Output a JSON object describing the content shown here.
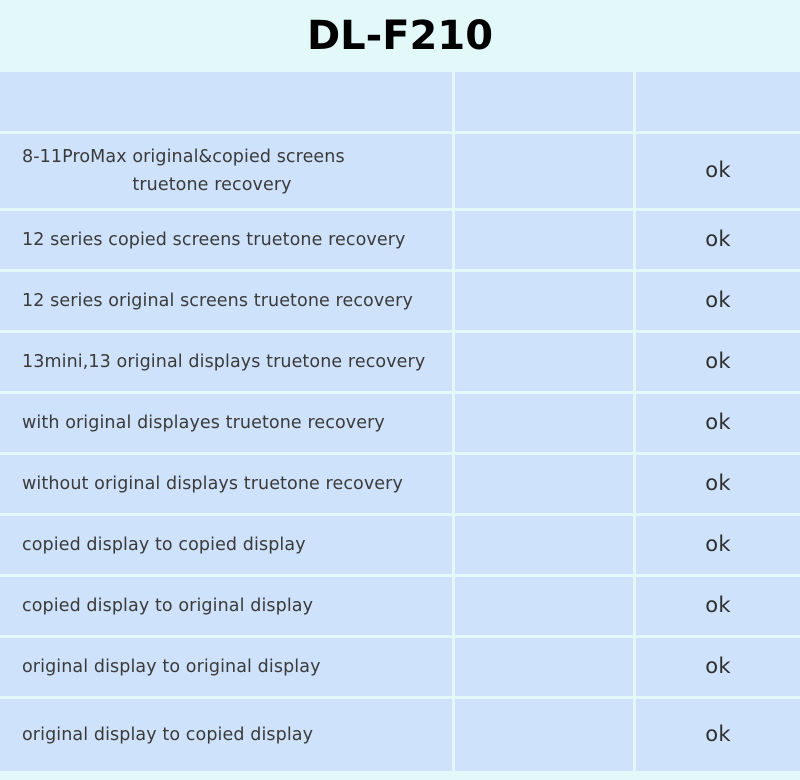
{
  "page": {
    "title": "DL-F210",
    "title_bg": "#e2f8f9",
    "cell_bg": "#cfe2fb",
    "grid_color": "#e2f8f9",
    "text_color": "#3a3a3a"
  },
  "table": {
    "columns": [
      {
        "key": "feature",
        "header": ""
      },
      {
        "key": "middle",
        "header": ""
      },
      {
        "key": "status",
        "header": ""
      }
    ],
    "rows": [
      {
        "feature_line1": "8-11ProMax original&copied screens",
        "feature_line2": "truetone recovery",
        "middle": "",
        "status": "ok"
      },
      {
        "feature_line1": "12 series copied screens truetone recovery",
        "feature_line2": "",
        "middle": "",
        "status": "ok"
      },
      {
        "feature_line1": "12 series original screens truetone recovery",
        "feature_line2": "",
        "middle": "",
        "status": "ok"
      },
      {
        "feature_line1": "13mini,13 original displays truetone recovery",
        "feature_line2": "",
        "middle": "",
        "status": "ok"
      },
      {
        "feature_line1": "with original displayes truetone recovery",
        "feature_line2": "",
        "middle": "",
        "status": "ok"
      },
      {
        "feature_line1": "without original displays truetone recovery",
        "feature_line2": "",
        "middle": "",
        "status": "ok"
      },
      {
        "feature_line1": "copied display to copied display",
        "feature_line2": "",
        "middle": "",
        "status": "ok"
      },
      {
        "feature_line1": "copied display to original display",
        "feature_line2": "",
        "middle": "",
        "status": "ok"
      },
      {
        "feature_line1": "original display to original display",
        "feature_line2": "",
        "middle": "",
        "status": "ok"
      },
      {
        "feature_line1": "original display to copied display",
        "feature_line2": "",
        "middle": "",
        "status": "ok"
      }
    ]
  }
}
